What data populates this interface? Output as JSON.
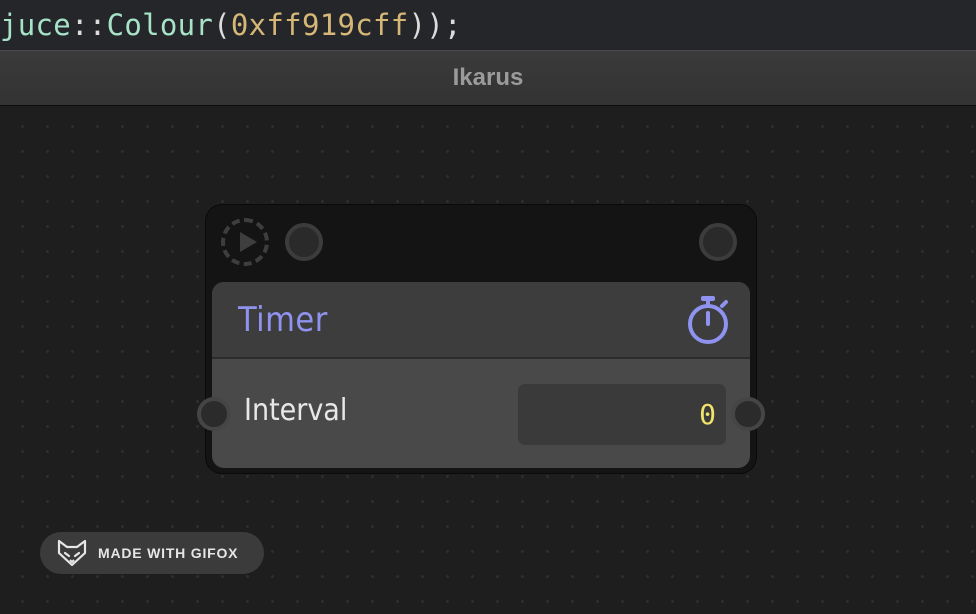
{
  "code_editor": {
    "namespace": "juce",
    "scope": "::",
    "class_name": "Colour",
    "open_paren": "(",
    "hex_value": "0xff919cff",
    "close": "));"
  },
  "window": {
    "title": "Ikarus"
  },
  "node": {
    "title": "Timer",
    "title_color": "#8f93ef",
    "icon": "stopwatch-icon",
    "flow_in_icon": "play-icon",
    "parameter": {
      "label": "Interval",
      "value": "0",
      "value_color": "#f0e26a"
    }
  },
  "watermark": {
    "text": "MADE WITH GIFOX",
    "icon": "fox-icon"
  }
}
